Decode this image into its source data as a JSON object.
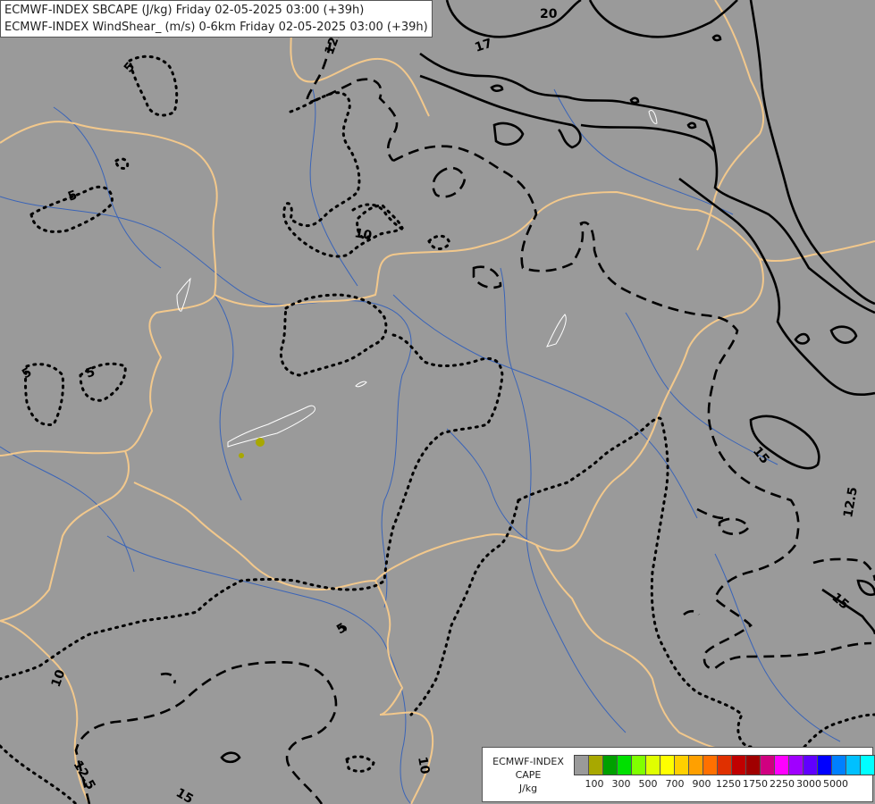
{
  "title_lines": [
    "ECMWF-INDEX SBCAPE (J/kg) Friday 02-05-2025 03:00 (+39h)",
    "ECMWF-INDEX WindShear_ (m/s) 0-6km Friday 02-05-2025 03:00 (+39h)"
  ],
  "contour_labels": [
    "20",
    "17",
    "12.5",
    "15",
    "5",
    "5",
    "10",
    "5",
    "5",
    "5",
    "15",
    "12.5",
    "15",
    "10",
    "12.5",
    "15",
    "10"
  ],
  "legend": {
    "line1": "ECMWF-INDEX",
    "line2": "CAPE",
    "line3": "J/kg",
    "colors": [
      "#9a9a9a",
      "#a8a800",
      "#00a000",
      "#00e000",
      "#80ff00",
      "#e0ff00",
      "#ffff00",
      "#ffd000",
      "#ffa000",
      "#ff7000",
      "#e03000",
      "#c00000",
      "#a00000",
      "#d00080",
      "#ff00ff",
      "#a000ff",
      "#6000ff",
      "#0000ff",
      "#0080ff",
      "#00c0ff",
      "#00ffff",
      "#ffffff"
    ],
    "ticks": [
      "100",
      "300",
      "500",
      "700",
      "900",
      "1250",
      "1750",
      "2250",
      "3000",
      "5000"
    ]
  },
  "map_colors": {
    "background": "#9a9a9a",
    "rivers": "#3a64b8",
    "borders": "#f2c88c",
    "contours": "#000000",
    "lakes": "#ffffff",
    "cape_spot": "#a8a800"
  }
}
